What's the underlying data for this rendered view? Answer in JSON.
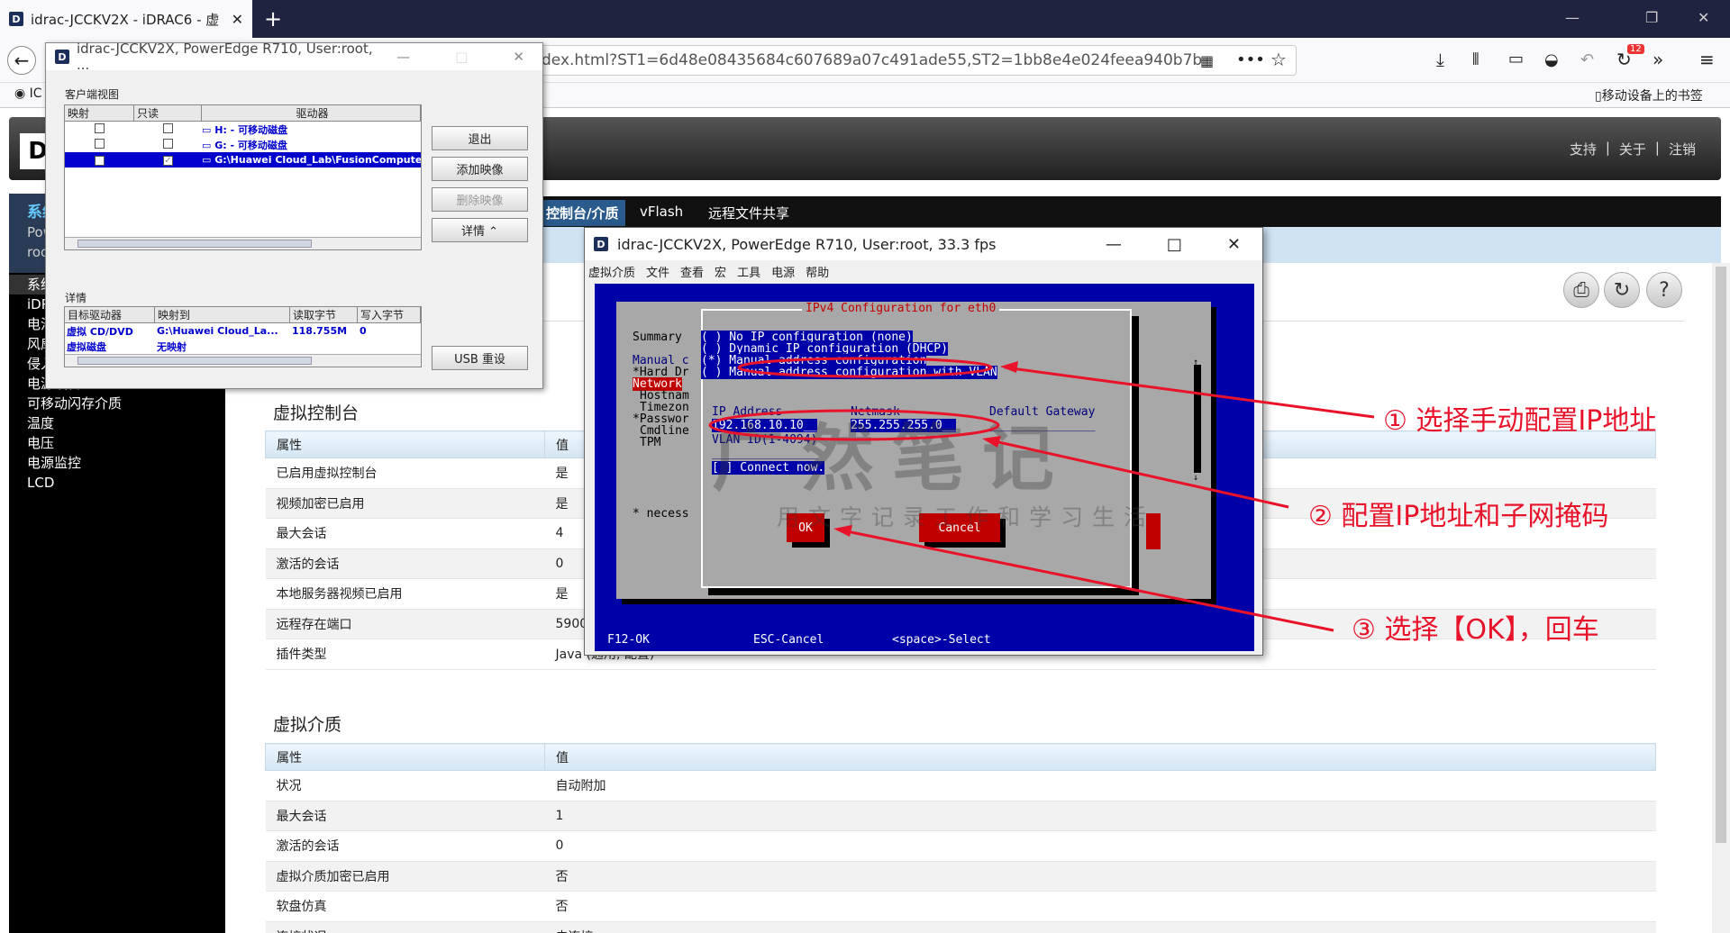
{
  "browser": {
    "tab_title": "idrac-JCCKV2X - iDRAC6 - 虚",
    "url": "dex.html?ST1=6d48e08435684c607689a07c491ade55,ST2=1bb8e4e024feea940b7b",
    "bookmark_left": "IC",
    "bookmark_right": "移动设备上的书签",
    "badge_count": "12"
  },
  "idrac": {
    "links": [
      "支持",
      "|",
      "关于",
      "|",
      "注销"
    ],
    "sidebar_top": [
      "系统",
      "Pow",
      "roo"
    ],
    "sidebar_items": [
      "系统",
      "iDR",
      "电池",
      "风扇",
      "侵入",
      "电源设备",
      "可移动闪存介质",
      "温度",
      "电压",
      "电源监控",
      "LCD"
    ],
    "tabs": [
      "控制台/介质",
      "vFlash",
      "远程文件共享"
    ],
    "console_section": {
      "title": "虚拟控制台",
      "headers": [
        "属性",
        "值"
      ],
      "rows": [
        [
          "已启用虚拟控制台",
          "是"
        ],
        [
          "视频加密已启用",
          "是"
        ],
        [
          "最大会话",
          "4"
        ],
        [
          "激活的会话",
          "0"
        ],
        [
          "本地服务器视频已启用",
          "是"
        ],
        [
          "远程存在端口",
          "5900"
        ],
        [
          "插件类型",
          "Java (通用, 配置)"
        ]
      ]
    },
    "media_section": {
      "title": "虚拟介质",
      "headers": [
        "属性",
        "值"
      ],
      "rows": [
        [
          "状况",
          "自动附加"
        ],
        [
          "最大会话",
          "1"
        ],
        [
          "激活的会话",
          "0"
        ],
        [
          "虚拟介质加密已启用",
          "否"
        ],
        [
          "软盘仿真",
          "否"
        ],
        [
          "连接状况",
          "未连接"
        ]
      ]
    }
  },
  "vm_dialog": {
    "title": "idrac-JCCKV2X, PowerEdge R710, User:root, ...",
    "client_view_label": "客户端视图",
    "headers": [
      "映射",
      "只读",
      "驱动器"
    ],
    "drives": [
      {
        "label": "H: - 可移动磁盘",
        "mapped": false,
        "readonly": false
      },
      {
        "label": "G: - 可移动磁盘",
        "mapped": false,
        "readonly": false
      },
      {
        "label": "G:\\Huawei Cloud_Lab\\FusionCompute\\Fu",
        "mapped": true,
        "readonly": true
      }
    ],
    "buttons": [
      "退出",
      "添加映像",
      "删除映像",
      "详情 ⌃"
    ],
    "usb_button": "USB 重设",
    "details_label": "详情",
    "detail_headers": [
      "目标驱动器",
      "映射到",
      "读取字节",
      "写入字节"
    ],
    "detail_rows": [
      [
        "虚拟 CD/DVD",
        "G:\\Huawei Cloud_La...",
        "118.755M",
        "0"
      ],
      [
        "虚拟磁盘",
        "无映射",
        "",
        ""
      ]
    ]
  },
  "console": {
    "title": "idrac-JCCKV2X, PowerEdge R710, User:root, 33.3 fps",
    "menu": [
      "虚拟介质",
      "文件",
      "查看",
      "宏",
      "工具",
      "电源",
      "帮助"
    ],
    "dialog_title": "IPv4 Configuration for eth0",
    "options": [
      "( ) No IP configuration (none)",
      "( ) Dynamic IP configuration (DHCP)",
      "(*) Manual address configuration",
      "( ) Manual address configuration with VLAN"
    ],
    "left_items": [
      "Summary",
      "Manual c",
      "*Hard Dr",
      "Network",
      "Hostnam",
      "Timezon",
      "*Passwor",
      "Cmdline",
      "TPM",
      "* necess"
    ],
    "field_labels": [
      "IP Address",
      "Netmask",
      "Default Gateway"
    ],
    "ip": "192.168.10.10__",
    "netmask": "255.255.255.0__",
    "vlan": "VLAN ID(1-4094)",
    "connect": "[ ] Connect now.",
    "ok": "OK",
    "cancel": "Cancel",
    "footer": [
      "F12-OK",
      "ESC-Cancel",
      "<space>-Select"
    ]
  },
  "annotations": [
    "① 选择手动配置IP地址",
    "② 配置IP地址和子网掩码",
    "③ 选择【OK】，回车"
  ],
  "watermark": [
    "广然笔记",
    "用文字记录工作和学习生活"
  ],
  "colors": {
    "annotation": "#e8132a",
    "terminal_bg": "#0000a8",
    "button_red": "#c00000"
  }
}
